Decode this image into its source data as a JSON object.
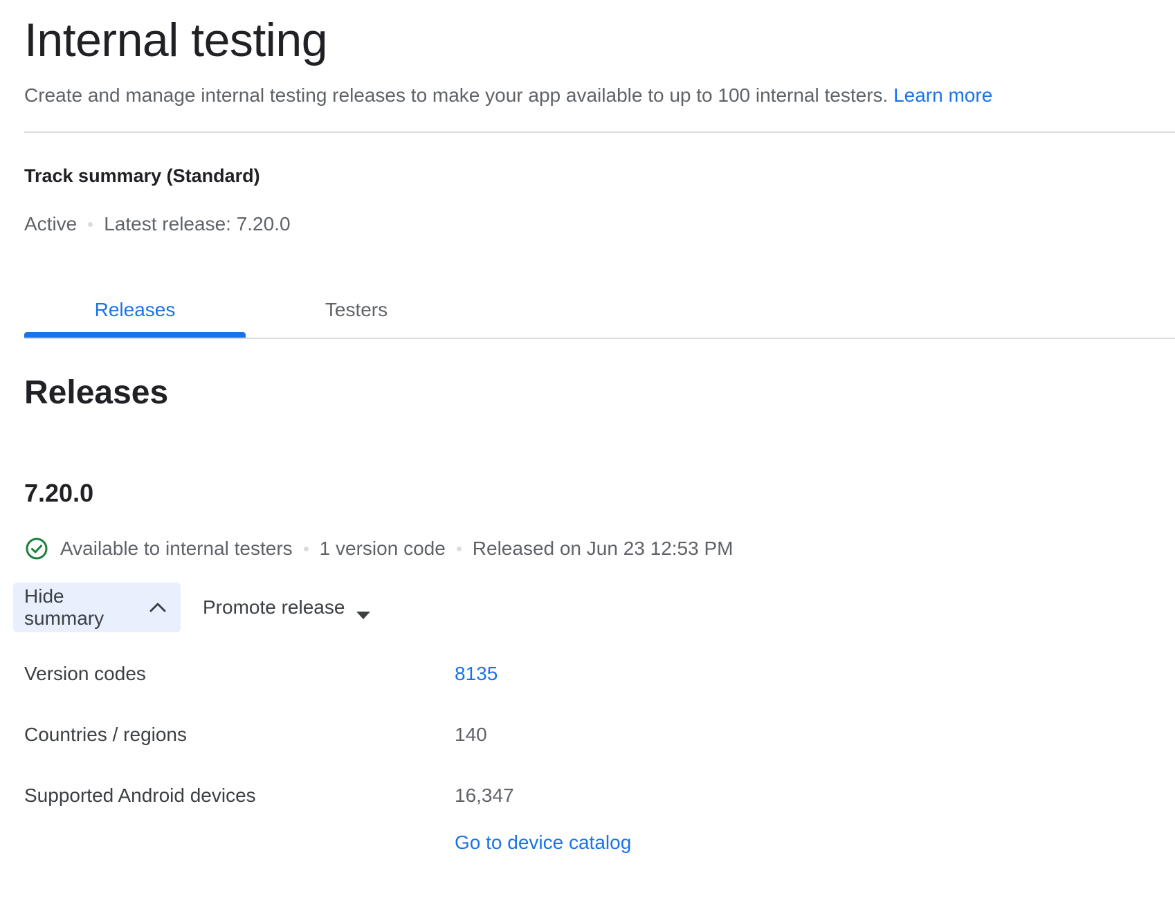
{
  "header": {
    "title": "Internal testing",
    "description": "Create and manage internal testing releases to make your app available to up to 100 internal testers.",
    "learn_more": "Learn more"
  },
  "track": {
    "title": "Track summary (Standard)",
    "status": "Active",
    "latest_release": "Latest release: 7.20.0"
  },
  "tabs": [
    {
      "label": "Releases",
      "active": true
    },
    {
      "label": "Testers",
      "active": false
    }
  ],
  "releases": {
    "section_title": "Releases",
    "release": {
      "version": "7.20.0",
      "availability": "Available to internal testers",
      "version_code_count": "1 version code",
      "released_on": "Released on Jun 23 12:53 PM",
      "status_color": "#188038"
    },
    "actions": {
      "hide_summary": "Hide summary",
      "promote_release": "Promote release"
    },
    "summary": {
      "version_codes_label": "Version codes",
      "version_codes_value": "8135",
      "countries_label": "Countries / regions",
      "countries_value": "140",
      "devices_label": "Supported Android devices",
      "devices_value": "16,347",
      "device_catalog_link": "Go to device catalog"
    }
  },
  "colors": {
    "accent": "#1a73e8",
    "hide_button_bg": "#e8f0fe",
    "divider": "#dadce0"
  }
}
